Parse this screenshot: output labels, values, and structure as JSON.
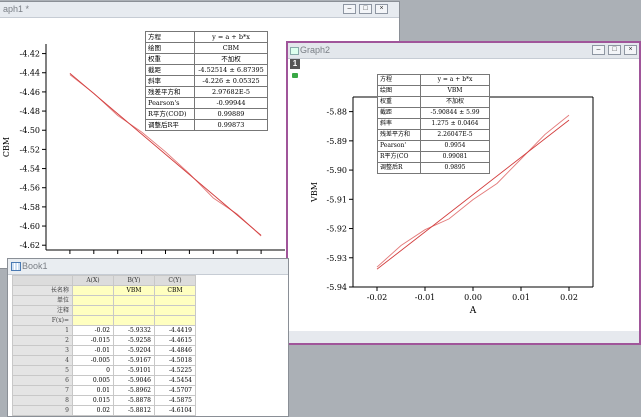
{
  "window1": {
    "title": "aph1 *",
    "stats": {
      "headers": [
        "方程",
        "y = a + b*x"
      ],
      "rows": [
        [
          "绘图",
          "CBM"
        ],
        [
          "权重",
          "不加权"
        ],
        [
          "截距",
          "-4.52514 ± 6.87395"
        ],
        [
          "斜率",
          "-4.226 ± 0.05325"
        ],
        [
          "残差平方和",
          "2.97682E-5"
        ],
        [
          "Pearson's",
          "-0.99944"
        ],
        [
          "R平方(COD)",
          "0.99889"
        ],
        [
          "调整后R平",
          "0.99873"
        ]
      ]
    },
    "chart_data": {
      "type": "line",
      "ylabel": "CBM",
      "yticks": [
        "-4.42",
        "-4.44",
        "-4.46",
        "-4.48",
        "-4.50",
        "-4.52",
        "-4.54",
        "-4.56",
        "-4.58",
        "-4.60",
        "-4.62"
      ],
      "ylim": [
        -4.625,
        -4.41
      ],
      "xlim": [
        -0.025,
        0.025
      ],
      "series": [
        {
          "x": [
            -0.02,
            -0.015,
            -0.01,
            -0.005,
            0,
            0.005,
            0.01,
            0.015,
            0.02
          ],
          "y": [
            -4.4419,
            -4.4615,
            -4.4846,
            -4.5018,
            -4.5225,
            -4.5454,
            -4.5707,
            -4.5875,
            -4.6104
          ],
          "color": "#e37a7a"
        },
        {
          "x": [
            -0.02,
            0.02
          ],
          "y": [
            -4.4406,
            -4.6097
          ],
          "color": "#d23c3c"
        }
      ]
    }
  },
  "window2": {
    "title": "Graph2",
    "layer_badge": "1",
    "stats": {
      "headers": [
        "方程",
        "y = a + b*x"
      ],
      "rows": [
        [
          "绘图",
          "VBM"
        ],
        [
          "权重",
          "不加权"
        ],
        [
          "截距",
          "-5.90844 ± 5.99"
        ],
        [
          "斜率",
          "1.275 ± 0.0464"
        ],
        [
          "残差平方和",
          "2.26047E-5"
        ],
        [
          "Pearson'",
          "0.9954"
        ],
        [
          "R平方(CO",
          "0.99081"
        ],
        [
          "调整后R",
          "0.9895"
        ]
      ]
    },
    "chart_data": {
      "type": "line",
      "xlabel": "A",
      "ylabel": "VBM",
      "xticks": [
        "-0.02",
        "-0.01",
        "0.00",
        "0.01",
        "0.02"
      ],
      "xtick_values": [
        -0.02,
        -0.01,
        0,
        0.01,
        0.02
      ],
      "yticks": [
        "-5.88",
        "-5.89",
        "-5.90",
        "-5.91",
        "-5.92",
        "-5.93",
        "-5.94"
      ],
      "ytick_values": [
        -5.88,
        -5.89,
        -5.9,
        -5.91,
        -5.92,
        -5.93,
        -5.94
      ],
      "xlim": [
        -0.025,
        0.025
      ],
      "ylim": [
        -5.94,
        -5.875
      ],
      "series": [
        {
          "x": [
            -0.02,
            -0.015,
            -0.01,
            -0.005,
            0,
            0.005,
            0.01,
            0.015,
            0.02
          ],
          "y": [
            -5.9332,
            -5.9258,
            -5.9204,
            -5.9167,
            -5.9101,
            -5.9046,
            -5.8962,
            -5.8878,
            -5.8812
          ],
          "color": "#e37a7a"
        },
        {
          "x": [
            -0.02,
            0.02
          ],
          "y": [
            -5.9339,
            -5.8829
          ],
          "color": "#d23c3c"
        }
      ]
    }
  },
  "book": {
    "title": "Book1",
    "columns": [
      "A(X)",
      "B(Y)",
      "C(Y)"
    ],
    "meta_rows": [
      {
        "label": "长名称",
        "cells": [
          "",
          "VBM",
          "CBM"
        ]
      },
      {
        "label": "单位",
        "cells": [
          "",
          "",
          ""
        ]
      },
      {
        "label": "注释",
        "cells": [
          "",
          "",
          ""
        ]
      },
      {
        "label": "F(x)=",
        "cells": [
          "",
          "",
          ""
        ]
      }
    ],
    "rows": [
      [
        "1",
        "-0.02",
        "-5.9332",
        "-4.4419"
      ],
      [
        "2",
        "-0.015",
        "-5.9258",
        "-4.4615"
      ],
      [
        "3",
        "-0.01",
        "-5.9204",
        "-4.4846"
      ],
      [
        "4",
        "-0.005",
        "-5.9167",
        "-4.5018"
      ],
      [
        "5",
        "0",
        "-5.9101",
        "-4.5225"
      ],
      [
        "6",
        "0.005",
        "-5.9046",
        "-4.5454"
      ],
      [
        "7",
        "0.01",
        "-5.8962",
        "-4.5707"
      ],
      [
        "8",
        "0.015",
        "-5.8878",
        "-4.5875"
      ],
      [
        "9",
        "0.02",
        "-5.8812",
        "-4.6104"
      ]
    ]
  },
  "colors": {
    "active_border": "#a0559a",
    "fit_line": "#d23c3c",
    "data_line": "#e37a7a"
  }
}
